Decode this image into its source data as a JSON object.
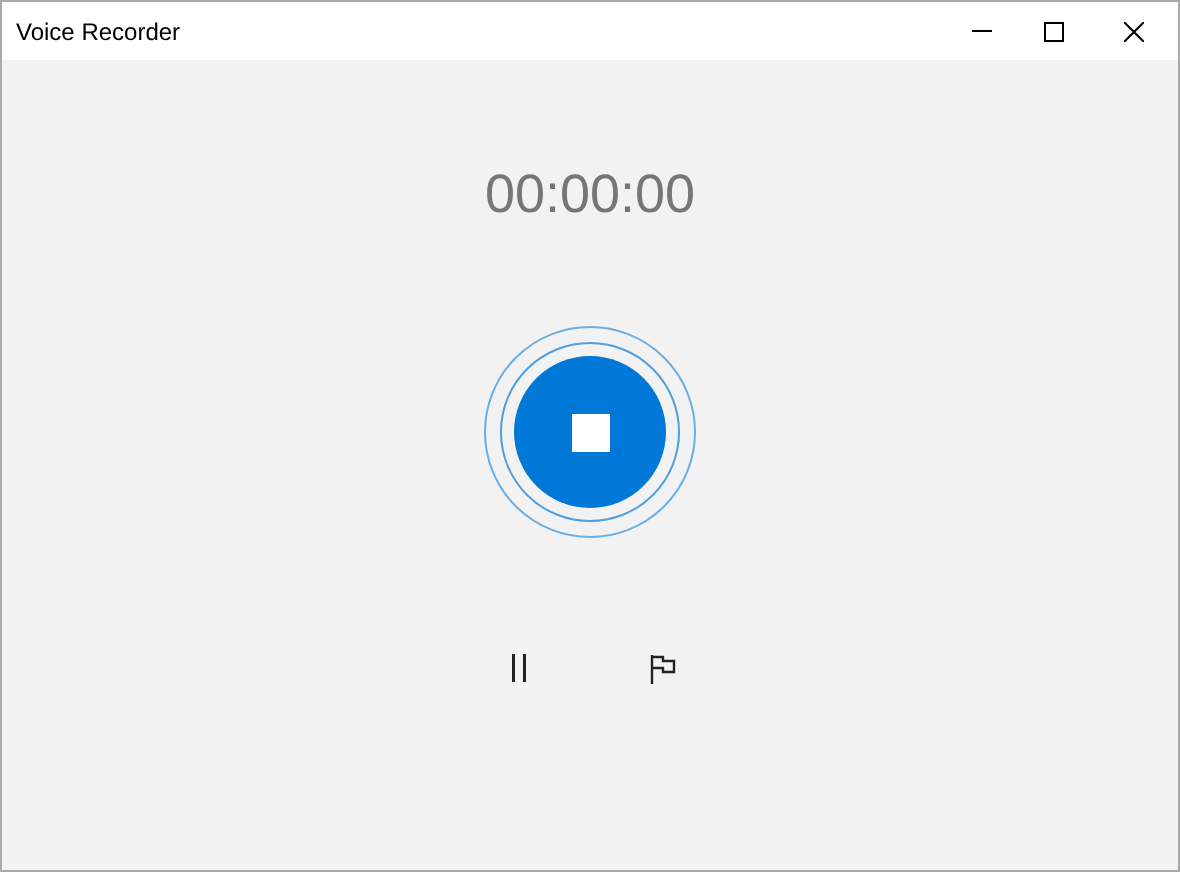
{
  "window": {
    "title": "Voice Recorder"
  },
  "timer": "00:00:00"
}
